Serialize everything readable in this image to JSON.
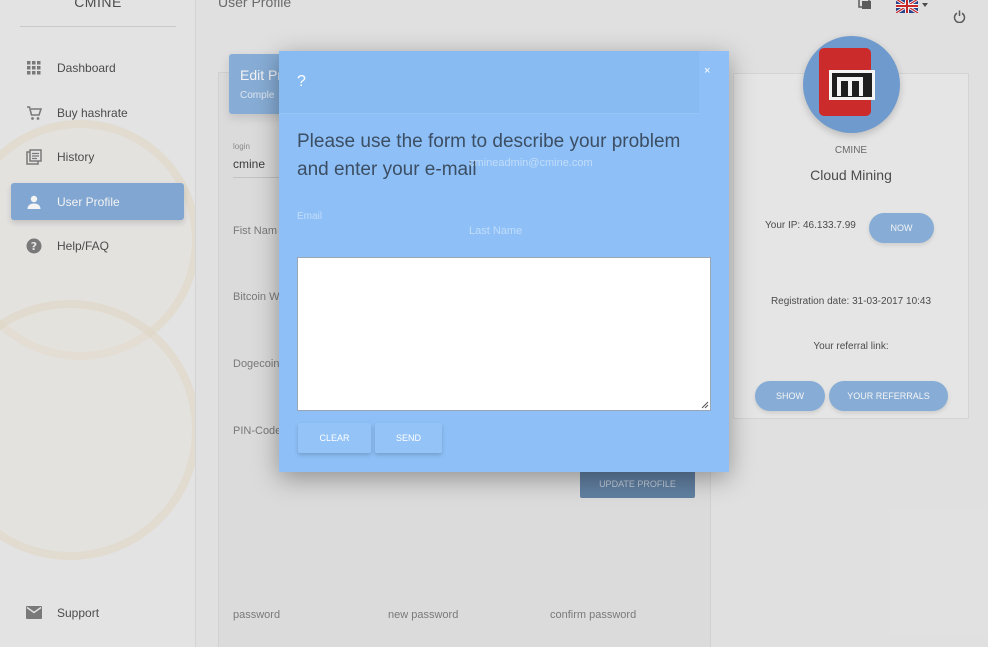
{
  "brand": "CMINE",
  "header": {
    "page_title": "User Profile"
  },
  "sidebar": {
    "items": [
      {
        "label": "Dashboard",
        "icon": "grid-icon"
      },
      {
        "label": "Buy hashrate",
        "icon": "cart-icon"
      },
      {
        "label": "History",
        "icon": "history-icon"
      },
      {
        "label": "User Profile",
        "icon": "person-icon",
        "active": true
      },
      {
        "label": "Help/FAQ",
        "icon": "help-icon"
      }
    ],
    "support": {
      "label": "Support",
      "icon": "mail-icon"
    }
  },
  "profile_form": {
    "header_title": "Edit Pro",
    "header_subtitle": "Comple",
    "login_label": "login",
    "login_value": "cmine",
    "email_value": "cmineadmin@cmine.com",
    "email_label": "Email",
    "first_name_label": "Fist Nam",
    "last_name_label": "Last Name",
    "bitcoin_label": "Bitcoin Wa",
    "dogecoin_label": "Dogecoin W",
    "pin_label": "PIN-Code",
    "update_button": "UPDATE PROFILE",
    "password_label": "password",
    "new_password_label": "new password",
    "confirm_password_label": "confirm password"
  },
  "profile_card": {
    "company": "CMINE",
    "tagline": "Cloud Mining",
    "ip_text": "Your IP: 46.133.7.99",
    "now_button": "NOW",
    "registration": "Registration date: 31-03-2017 10:43",
    "referral_label": "Your referral link:",
    "show_button": "SHOW",
    "referrals_button": "YOUR REFERRALS"
  },
  "modal": {
    "title": "?",
    "close": "×",
    "message": "Please use the form to describe your problem and enter your e-mail",
    "textarea_value": "",
    "clear_button": "CLEAR",
    "send_button": "SEND"
  },
  "colors": {
    "accent": "#86b0de",
    "modal_bg": "#8ec0f7",
    "logo_red": "#d32020"
  }
}
